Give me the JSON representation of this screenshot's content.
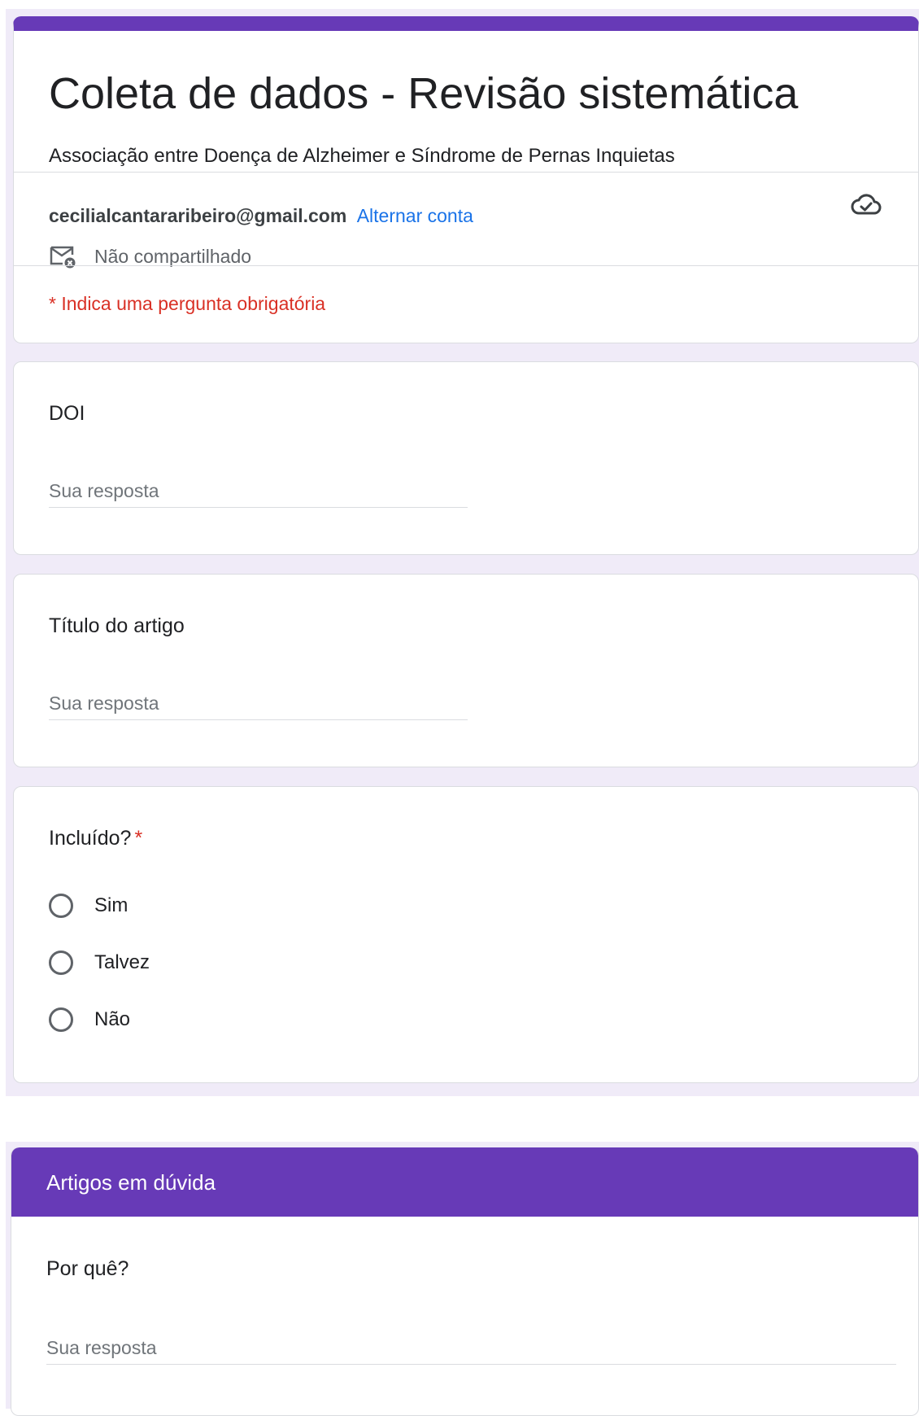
{
  "form": {
    "title": "Coleta de dados - Revisão sistemática",
    "description": "Associação entre Doença de Alzheimer e Síndrome de Pernas Inquietas",
    "accent_color": "#673ab7",
    "background_color": "#f0ebf8"
  },
  "account": {
    "email": "cecilialcantararibeiro@gmail.com",
    "switch_label": "Alternar conta",
    "share_status": "Não compartilhado",
    "cloud_icon": "cloud-check-icon",
    "mail_icon": "mail-not-shared-icon"
  },
  "required_note": "* Indica uma pergunta obrigatória",
  "questions": [
    {
      "title": "DOI",
      "placeholder": "Sua resposta",
      "value": ""
    },
    {
      "title": "Título do artigo",
      "placeholder": "Sua resposta",
      "value": ""
    },
    {
      "title": "Incluído?",
      "required_mark": "*",
      "options": [
        "Sim",
        "Talvez",
        "Não"
      ]
    }
  ],
  "section": {
    "title": "Artigos em dúvida",
    "question": {
      "title": "Por quê?",
      "placeholder": "Sua resposta",
      "value": ""
    }
  }
}
